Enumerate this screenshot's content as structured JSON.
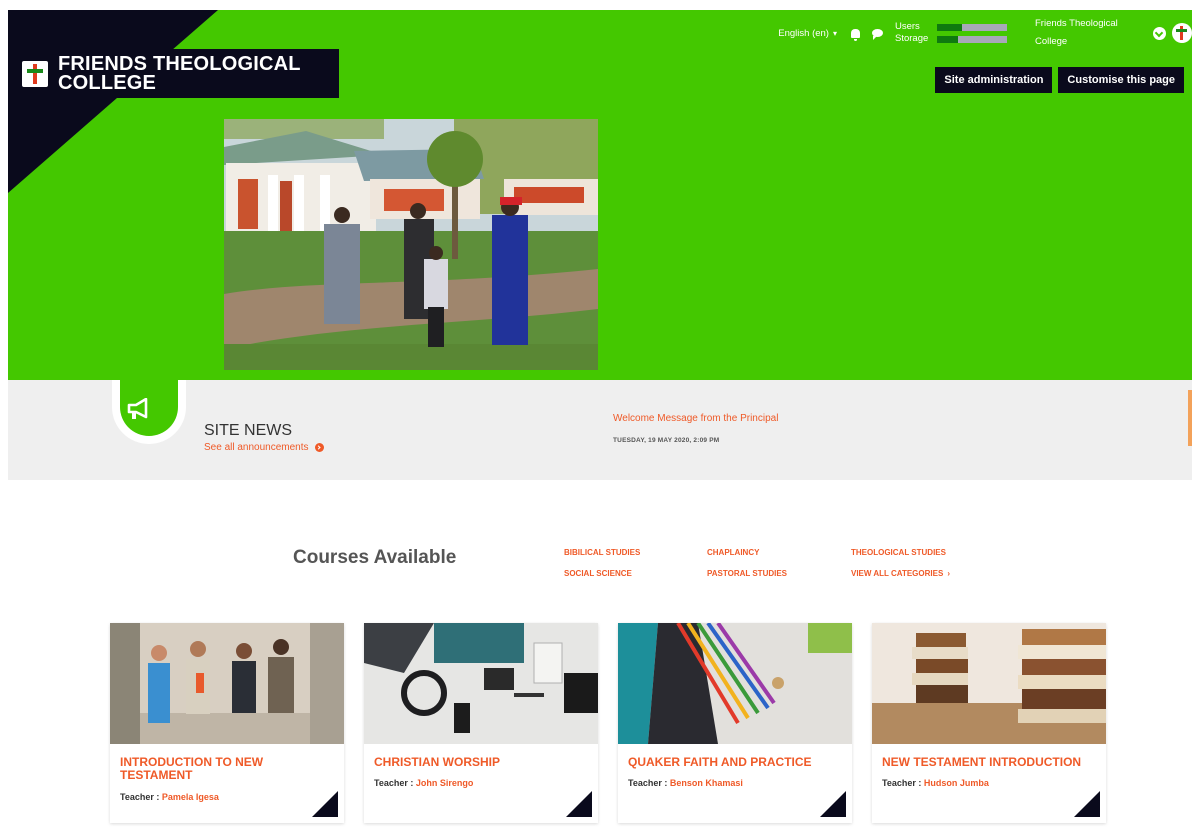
{
  "brand": {
    "name": "FRIENDS THEOLOGICAL COLLEGE"
  },
  "topbar": {
    "language": "English (en)",
    "quota": [
      {
        "label": "Users",
        "fill": 0.35
      },
      {
        "label": "Storage",
        "fill": 0.3
      }
    ],
    "user_name": "Friends Theological College"
  },
  "actions": {
    "site_admin": "Site administration",
    "customise": "Customise this page"
  },
  "news": {
    "title": "SITE NEWS",
    "see_all": "See all announcements",
    "item_title": "Welcome Message from the Principal",
    "item_date": "TUESDAY, 19 MAY 2020, 2:09 PM"
  },
  "courses": {
    "heading": "Courses Available",
    "categories": [
      "BIBILICAL STUDIES",
      "CHAPLAINCY",
      "THEOLOGICAL STUDIES",
      "SOCIAL SCIENCE",
      "PASTORAL STUDIES",
      "VIEW ALL CATEGORIES"
    ],
    "teacher_label": "Teacher : ",
    "cards": [
      {
        "title": "INTRODUCTION TO NEW TESTAMENT",
        "teacher": "Pamela Igesa"
      },
      {
        "title": "CHRISTIAN WORSHIP",
        "teacher": "John Sirengo"
      },
      {
        "title": "QUAKER FAITH AND PRACTICE",
        "teacher": "Benson Khamasi"
      },
      {
        "title": "NEW TESTAMENT INTRODUCTION",
        "teacher": "Hudson Jumba"
      }
    ]
  },
  "colors": {
    "brand_green": "#44c800",
    "accent_orange": "#ef5a28",
    "dark": "#0a0a1c"
  }
}
